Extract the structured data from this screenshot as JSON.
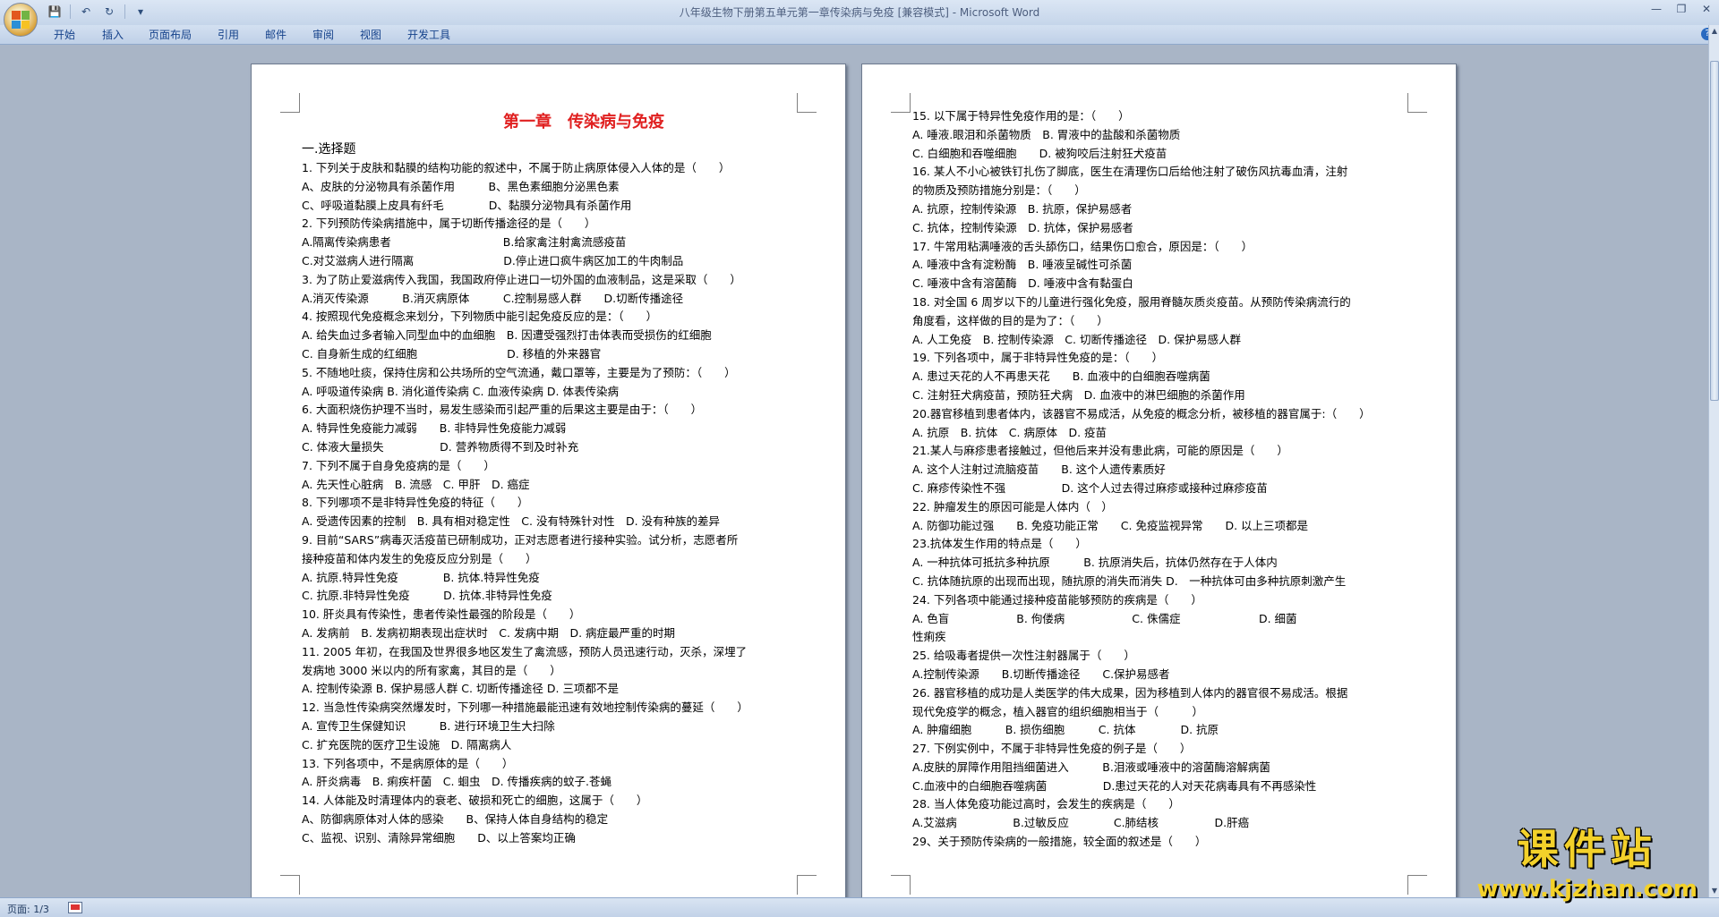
{
  "window": {
    "title": "八年级生物下册第五单元第一章传染病与免疫 [兼容模式] - Microsoft Word"
  },
  "qat": [
    "save-icon",
    "undo-icon",
    "redo-icon",
    "customize-icon"
  ],
  "ribbon": {
    "tabs": [
      "开始",
      "插入",
      "页面布局",
      "引用",
      "邮件",
      "审阅",
      "视图",
      "开发工具"
    ]
  },
  "document": {
    "title": "第一章　传染病与免疫",
    "section": "一.选择题",
    "page1_lines": [
      "1. 下列关于皮肤和黏膜的结构功能的叙述中，不属于防止病原体侵入人体的是（　　）",
      "A、皮肤的分泌物具有杀菌作用　　　B、黑色素细胞分泌黑色素",
      "C、呼吸道黏膜上皮具有纤毛　　　　D、黏膜分泌物具有杀菌作用",
      "2. 下列预防传染病措施中，属于切断传播途径的是（　　）",
      "A.隔离传染病患者　　　　　　　　　　B.给家禽注射禽流感疫苗",
      "C.对艾滋病人进行隔离　　　　　　　　D.停止进口疯牛病区加工的牛肉制品",
      "3. 为了防止爱滋病传入我国，我国政府停止进口一切外国的血液制品，这是采取（　　）",
      "A.消灭传染源　　　B.消灭病原体　　　C.控制易感人群　　D.切断传播途径",
      "4. 按照现代免疫概念来划分，下列物质中能引起免疫反应的是：（　　）",
      "A. 给失血过多者输入同型血中的血细胞　B. 因遭受强烈打击体表而受损伤的红细胞",
      "C. 自身新生成的红细胞　　　　　　　　D. 移植的外来器官",
      "5. 不随地吐痰，保持住房和公共场所的空气流通，戴口罩等，主要是为了预防：（　　）",
      "A. 呼吸道传染病 B. 消化道传染病 C. 血液传染病 D. 体表传染病",
      "6. 大面积烧伤护理不当时，易发生感染而引起严重的后果这主要是由于：（　　）",
      "A. 特异性免疫能力减弱　　B. 非特异性免疫能力减弱",
      "C. 体液大量损失　　　　　D. 营养物质得不到及时补充",
      "7. 下列不属于自身免疫病的是（　　）",
      "A. 先天性心脏病　B. 流感　C. 甲肝　D. 癌症",
      "8. 下列哪项不是非特异性免疫的特征（　　）",
      "A. 受遗传因素的控制　B. 具有相对稳定性　C. 没有特殊针对性　D. 没有种族的差异",
      "9. 目前“SARS”病毒灭活疫苗已研制成功，正对志愿者进行接种实验。试分析，志愿者所",
      "接种疫苗和体内发生的免疫反应分别是（　　）",
      "A. 抗原.特异性免疫　　　　B. 抗体.特异性免疫",
      "C. 抗原.非特异性免疫　　　D. 抗体.非特异性免疫",
      "10. 肝炎具有传染性，患者传染性最强的阶段是（　　）",
      "A. 发病前　B. 发病初期表现出症状时　C. 发病中期　D. 病症最严重的时期",
      "11. 2005 年初，在我国及世界很多地区发生了禽流感，预防人员迅速行动，灭杀，深埋了",
      "发病地 3000 米以内的所有家禽，其目的是（　　）",
      "A. 控制传染源 B. 保护易感人群 C. 切断传播途径 D. 三项都不是",
      "12. 当急性传染病突然爆发时，下列哪一种措施最能迅速有效地控制传染病的蔓延（　　）",
      "A. 宣传卫生保健知识　　　B. 进行环境卫生大扫除",
      "C. 扩充医院的医疗卫生设施　D. 隔离病人",
      "13. 下列各项中，不是病原体的是（　　）",
      "A. 肝炎病毒　B. 痢疾杆菌　C. 蛔虫　D. 传播疾病的蚊子.苍蝇",
      "14. 人体能及时清理体内的衰老、破损和死亡的细胞，这属于（　　）",
      "A、防御病原体对人体的感染　　B、保持人体自身结构的稳定",
      "C、监视、识别、清除异常细胞　　D、以上答案均正确"
    ],
    "page2_lines": [
      "15. 以下属于特异性免疫作用的是：（　　）",
      "A. 唾液.眼泪和杀菌物质　B. 胃液中的盐酸和杀菌物质",
      "C. 白细胞和吞噬细胞　　D. 被狗咬后注射狂犬疫苗",
      "16. 某人不小心被铁钉扎伤了脚底，医生在清理伤口后给他注射了破伤风抗毒血清，注射",
      "的物质及预防措施分别是：（　　）",
      "A. 抗原，控制传染源　B. 抗原，保护易感者",
      "C. 抗体，控制传染源　D. 抗体，保护易感者",
      "17. 牛常用粘满唾液的舌头舔伤口，结果伤口愈合，原因是：（　　）",
      "A. 唾液中含有淀粉酶　B. 唾液呈碱性可杀菌",
      "C. 唾液中含有溶菌酶　D. 唾液中含有黏蛋白",
      "18. 对全国 6 周岁以下的儿童进行强化免疫，服用脊髓灰质炎疫苗。从预防传染病流行的",
      "角度看，这样做的目的是为了：（　　）",
      "A. 人工免疫　B. 控制传染源　C. 切断传播途径　D. 保护易感人群",
      "19. 下列各项中，属于非特异性免疫的是：（　　）",
      "A. 患过天花的人不再患天花　　B. 血液中的白细胞吞噬病菌",
      "C. 注射狂犬病疫苗，预防狂犬病　D. 血液中的淋巴细胞的杀菌作用",
      "20.器官移植到患者体内，该器官不易成活，从免疫的概念分析，被移植的器官属于:（　　）",
      "A. 抗原　B. 抗体　C. 病原体　D. 疫苗",
      "21.某人与麻疹患者接触过，但他后来并没有患此病，可能的原因是（　　）",
      "A. 这个人注射过流脑疫苗　　B. 这个人遗传素质好",
      "C. 麻疹传染性不强　　　　　D. 这个人过去得过麻疹或接种过麻疹疫苗",
      "22. 肿瘤发生的原因可能是人体内（　）",
      "A. 防御功能过强　　B. 免疫功能正常　　C. 免疫监视异常　　D. 以上三项都是",
      "23.抗体发生作用的特点是（　　）",
      "A. 一种抗体可抵抗多种抗原　　　B. 抗原消失后，抗体仍然存在于人体内",
      "C. 抗体随抗原的出现而出现，随抗原的消失而消失 D.　一种抗体可由多种抗原刺激产生",
      "24. 下列各项中能通过接种疫苗能够预防的疾病是（　　）",
      "A. 色盲　　　　　　B. 佝偻病　　　　　　C. 侏儒症　　　　　　　D. 细菌",
      "性痢疾",
      "25. 给吸毒者提供一次性注射器属于（　　）",
      "A.控制传染源　　B.切断传播途径　　C.保护易感者",
      "26. 器官移植的成功是人类医学的伟大成果，因为移植到人体内的器官很不易成活。根据",
      "现代免疫学的概念，植入器官的组织细胞相当于（　　　）",
      "A. 肿瘤细胞　　　B. 损伤细胞　　　C. 抗体　　　　D. 抗原",
      "27. 下例实例中，不属于非特异性免疫的例子是（　　）",
      "A.皮肤的屏障作用阻挡细菌进入　　　B.泪液或唾液中的溶菌酶溶解病菌",
      "C.血液中的白细胞吞噬病菌　　　　　D.患过天花的人对天花病毒具有不再感染性",
      "28. 当人体免疫功能过高时，会发生的疾病是（　　）",
      "A.艾滋病　　　　　B.过敏反应　　　　C.肺结核　　　　　D.肝癌",
      "29、关于预防传染病的一般措施，较全面的叙述是（　　）"
    ]
  },
  "status": {
    "page": "页面: 1/3"
  },
  "watermark": {
    "cn": "课件站",
    "url": "www.kjzhan.com"
  }
}
